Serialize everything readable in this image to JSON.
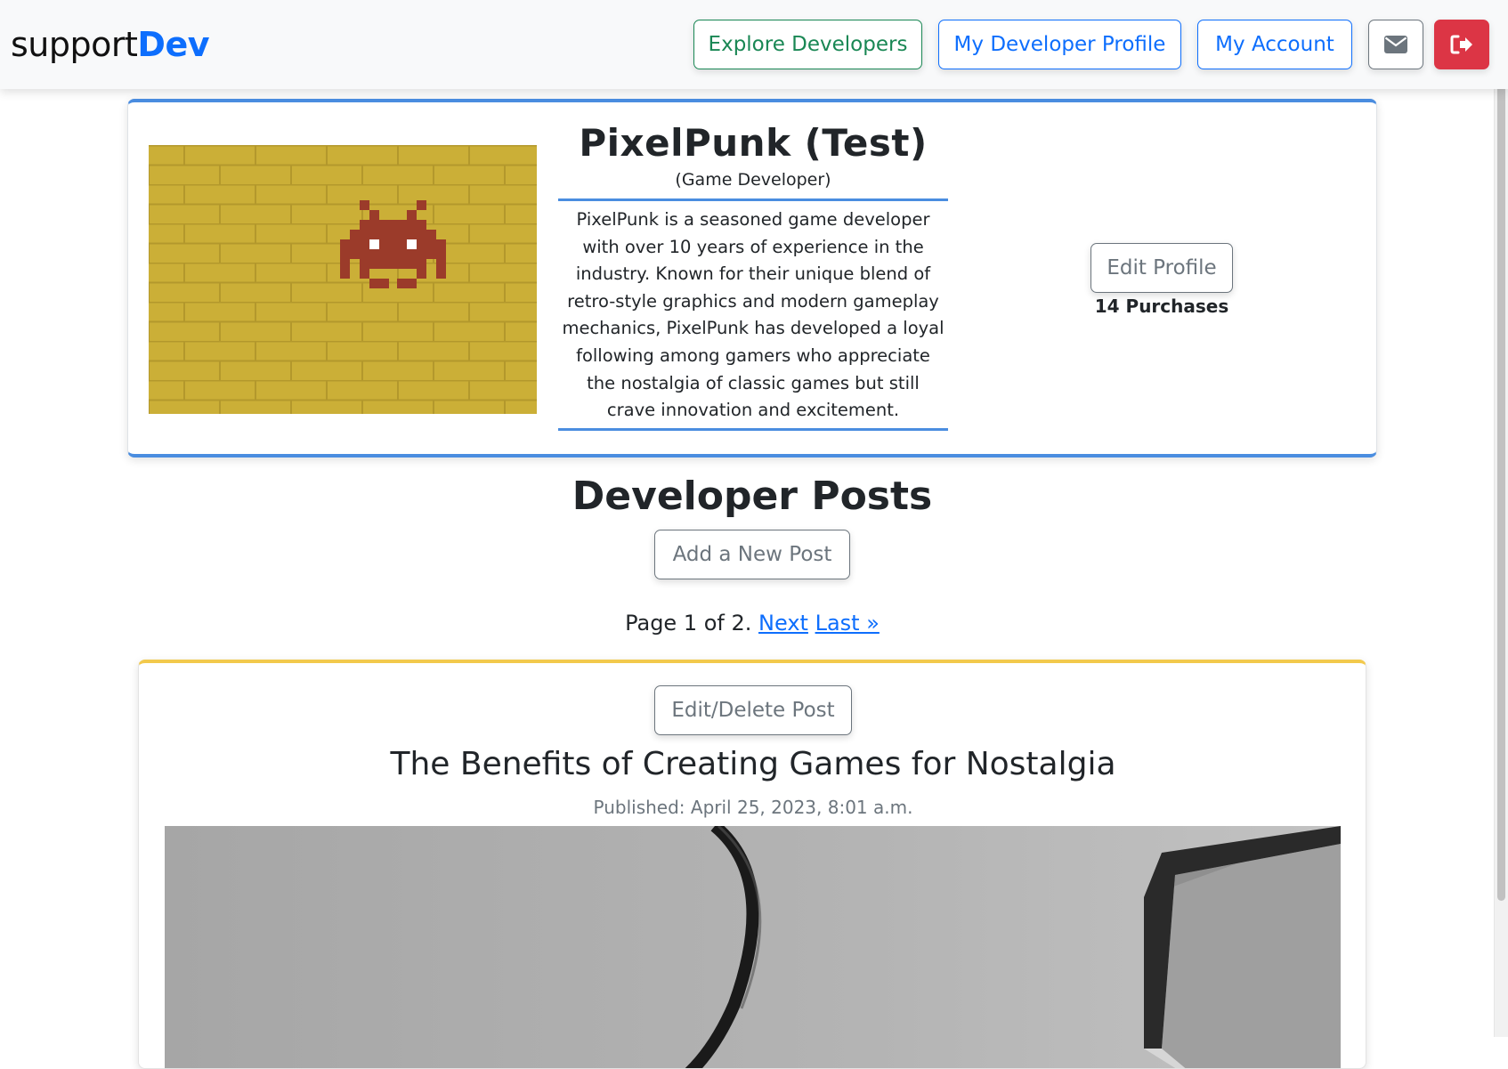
{
  "navbar": {
    "brand_prefix": "support",
    "brand_suffix": "Dev",
    "explore_label": "Explore Developers",
    "dev_profile_label": "My Developer Profile",
    "account_label": "My Account",
    "messages_icon": "envelope-icon",
    "logout_icon": "logout-icon"
  },
  "profile": {
    "name": "PixelPunk (Test)",
    "type": "(Game Developer)",
    "bio": "PixelPunk is a seasoned game developer with over 10 years of experience in the industry. Known for their unique blend of retro-style graphics and modern gameplay mechanics, PixelPunk has developed a loyal following among gamers who appreciate the nostalgia of classic games but still crave innovation and excitement.",
    "edit_label": "Edit Profile",
    "purchases": "14 Purchases"
  },
  "posts": {
    "heading": "Developer Posts",
    "add_label": "Add a New Post",
    "pagination": {
      "text": "Page 1 of 2. ",
      "next_label": "Next",
      "last_label": "Last »"
    },
    "items": [
      {
        "edit_label": "Edit/Delete Post",
        "title": "The Benefits of Creating Games for Nostalgia",
        "published": "Published: April 25, 2023, 8:01 a.m."
      }
    ]
  },
  "colors": {
    "brand_blue": "#0d6efd",
    "success_green": "#198754",
    "secondary_grey": "#6c757d",
    "danger_red": "#dc3545",
    "profile_border": "#4a8de0",
    "post_border": "#f2c94c"
  }
}
